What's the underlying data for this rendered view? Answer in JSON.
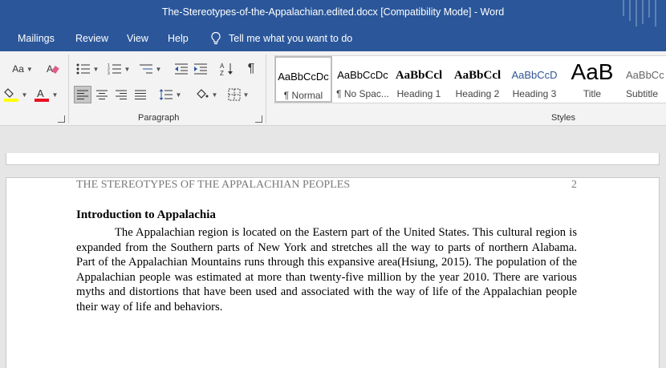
{
  "window": {
    "title": "The-Stereotypes-of-the-Appalachian.edited.docx  [Compatibility Mode]  -  Word"
  },
  "tabs": [
    {
      "label": "Mailings"
    },
    {
      "label": "Review"
    },
    {
      "label": "View"
    },
    {
      "label": "Help"
    }
  ],
  "tell_me": {
    "label": "Tell me what you want to do",
    "icon": "lightbulb-icon"
  },
  "ribbon": {
    "font_group": {
      "change_case_label": "Aa"
    },
    "paragraph_group": {
      "label": "Paragraph"
    },
    "styles_group": {
      "label": "Styles",
      "items": [
        {
          "sample": "AaBbCcDc",
          "name": "¶ Normal"
        },
        {
          "sample": "AaBbCcDc",
          "name": "¶ No Spac..."
        },
        {
          "sample": "AaBbCcl",
          "name": "Heading 1"
        },
        {
          "sample": "AaBbCcl",
          "name": "Heading 2"
        },
        {
          "sample": "AaBbCcD",
          "name": "Heading 3"
        },
        {
          "sample": "AaB",
          "name": "Title"
        },
        {
          "sample": "AaBbCc",
          "name": "Subtitle"
        }
      ]
    }
  },
  "colors": {
    "title_bar": "#2b579a",
    "highlight": "#ffff00",
    "font_color": "#e81123"
  },
  "document": {
    "running_head": "THE STEREOTYPES OF THE APPALACHIAN PEOPLES",
    "page_number": "2",
    "heading": "Introduction to Appalachia",
    "paragraph": "The Appalachian region is located on the Eastern part of the United States. This cultural region is expanded from the Southern parts of New York and stretches all the way to parts of northern Alabama. Part of the Appalachian Mountains runs through this expansive area(Hsiung, 2015). The population of the Appalachian people was estimated at more than twenty-five million by the year 2010. There are various myths and distortions that have been used and associated with the way of life of the Appalachian people their way of life and behaviors."
  }
}
